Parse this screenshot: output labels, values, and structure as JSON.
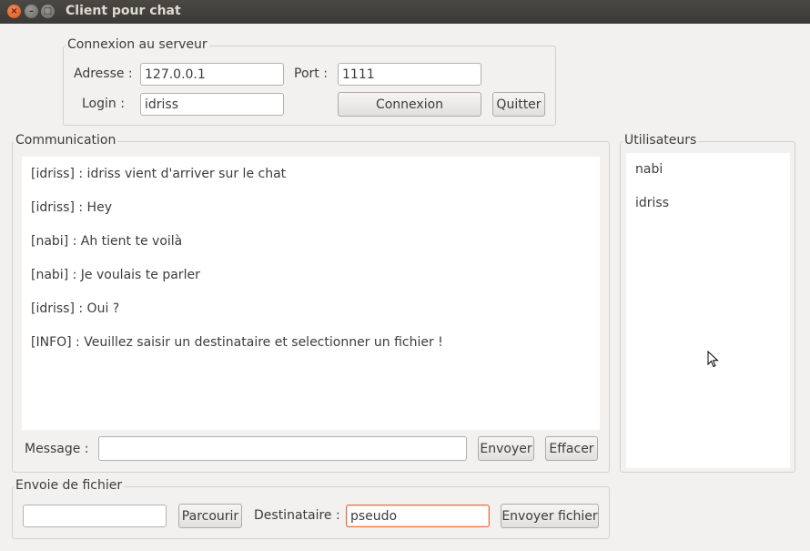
{
  "window": {
    "title": "Client pour chat",
    "buttons": {
      "close": "×",
      "minimize": "–",
      "maximize": "□"
    }
  },
  "connection": {
    "group_title": "Connexion au serveur",
    "address_label": "Adresse :",
    "address_value": "127.0.0.1",
    "port_label": "Port :",
    "port_value": "1111",
    "login_label": "Login :",
    "login_value": "idriss",
    "connect_button": "Connexion",
    "quit_button": "Quitter"
  },
  "communication": {
    "group_title": "Communication",
    "messages": [
      "[idriss] : idriss vient d'arriver sur le chat",
      "[idriss] : Hey",
      "[nabi] : Ah tient te voilà",
      "[nabi] : Je voulais te parler",
      "[idriss] : Oui ?",
      "[INFO] : Veuillez saisir un destinataire et selectionner un fichier !"
    ],
    "message_label": "Message :",
    "message_value": "",
    "send_button": "Envoyer",
    "clear_button": "Effacer"
  },
  "users": {
    "group_title": "Utilisateurs",
    "items": [
      "nabi",
      "idriss"
    ]
  },
  "file": {
    "group_title": "Envoie de fichier",
    "path_value": "",
    "browse_button": "Parcourir",
    "recipient_label": "Destinataire :",
    "recipient_value": "pseudo",
    "send_file_button": "Envoyer fichier"
  },
  "colors": {
    "titlebar": "#3b3a36",
    "window_bg": "#f2f1f0",
    "focus_border": "#e86c3a",
    "close_button": "#e0531a"
  }
}
